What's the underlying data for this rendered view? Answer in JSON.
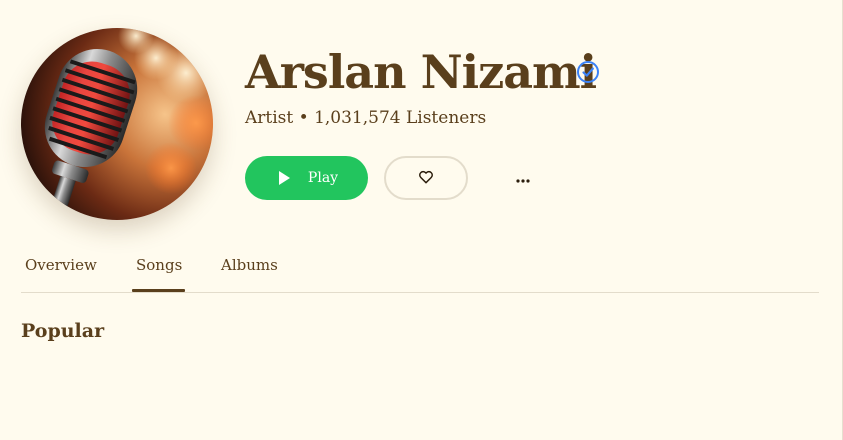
{
  "artist": {
    "name": "Arslan Nizami",
    "meta": "Artist • 1,031,574 Listeners",
    "verified": true,
    "avatar_icon": "microphone-photo"
  },
  "actions": {
    "play_label": "Play",
    "like_icon": "heart-icon",
    "more_icon": "more-horizontal-icon"
  },
  "tabs": [
    {
      "label": "Overview",
      "active": false
    },
    {
      "label": "Songs",
      "active": true
    },
    {
      "label": "Albums",
      "active": false
    }
  ],
  "section": {
    "title": "Popular"
  },
  "colors": {
    "background": "#fffbee",
    "text": "#5a3f1c",
    "play": "#22c55e",
    "verified": "#3b82f6",
    "border": "#e3dccb"
  }
}
